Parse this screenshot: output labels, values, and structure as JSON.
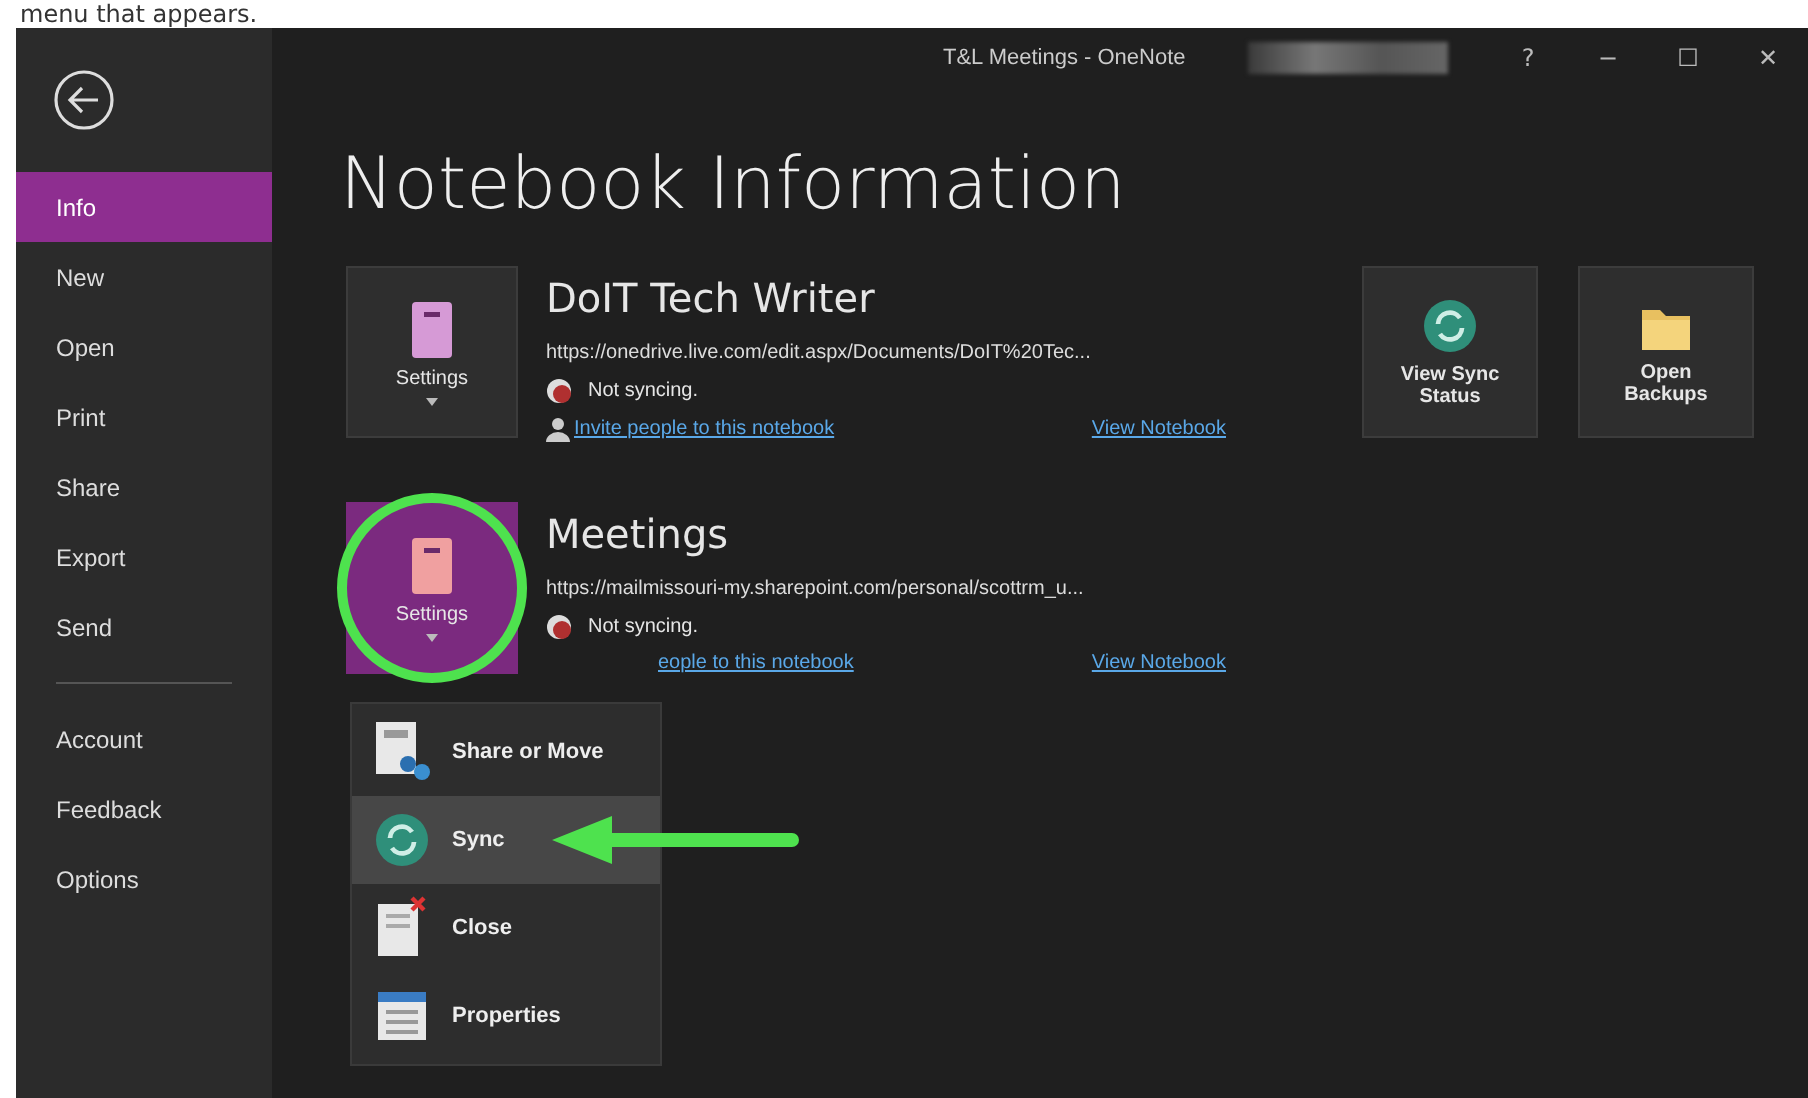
{
  "caption": "menu that appears.",
  "window": {
    "title": "T&L Meetings - OneNote",
    "controls": [
      "?",
      "−",
      "☐",
      "✕"
    ]
  },
  "sidebar": {
    "items": [
      {
        "label": "Info",
        "selected": true
      },
      {
        "label": "New",
        "selected": false
      },
      {
        "label": "Open",
        "selected": false
      },
      {
        "label": "Print",
        "selected": false
      },
      {
        "label": "Share",
        "selected": false
      },
      {
        "label": "Export",
        "selected": false
      },
      {
        "label": "Send",
        "selected": false
      }
    ],
    "lower_items": [
      {
        "label": "Account",
        "selected": false
      },
      {
        "label": "Feedback",
        "selected": false
      },
      {
        "label": "Options",
        "selected": false
      }
    ]
  },
  "heading": "Notebook Information",
  "notebooks": [
    {
      "settings_label": "Settings",
      "selected": false,
      "expanded": false,
      "title": "DoIT Tech Writer",
      "url": "https://onedrive.live.com/edit.aspx/Documents/DoIT%20Tec...",
      "status": "Not syncing.",
      "invite": "Invite people to this notebook",
      "invite_icon": true,
      "view": "View Notebook"
    },
    {
      "settings_label": "Settings",
      "selected": true,
      "expanded": true,
      "title": "Meetings",
      "url": "https://mailmissouri-my.sharepoint.com/personal/scottrm_u...",
      "status": "Not syncing.",
      "invite": "eople to this notebook",
      "invite_icon": false,
      "view": "View Notebook"
    }
  ],
  "settings_menu": [
    {
      "kind": "share",
      "label": "Share or Move",
      "selected": false
    },
    {
      "kind": "sync",
      "label": "Sync",
      "selected": true
    },
    {
      "kind": "close",
      "label": "Close",
      "selected": false
    },
    {
      "kind": "properties",
      "label": "Properties",
      "selected": false
    }
  ],
  "actions": [
    {
      "kind": "sync",
      "label": "View Sync Status"
    },
    {
      "kind": "backups",
      "label": "Open Backups"
    }
  ]
}
